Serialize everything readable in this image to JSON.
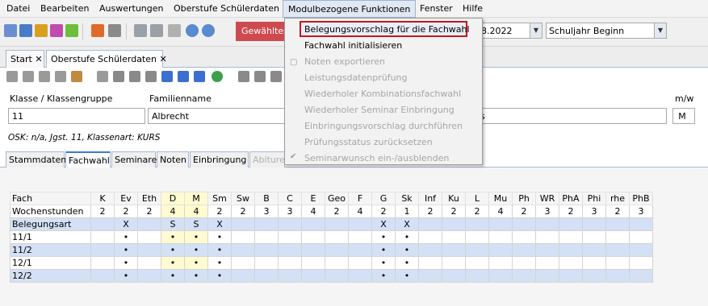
{
  "menu": [
    "Datei",
    "Bearbeiten",
    "Auswertungen",
    "Oberstufe Schülerdaten",
    "Modulbezogene Funktionen",
    "Fenster",
    "Hilfe"
  ],
  "toolbar": {
    "red_button": "Gewähltes",
    "date_value": "8.2022",
    "period_value": "Schuljahr Beginn"
  },
  "doc_tabs": [
    "Start",
    "Oberstufe Schülerdaten"
  ],
  "form": {
    "class_label": "Klasse / Klassengruppe",
    "class_value": "11",
    "surname_label": "Familienname",
    "surname_value": "Albrecht",
    "firstname_value": "s",
    "gender_label": "m/w",
    "gender_value": "M",
    "osk_info": "OSK: n/a, Jgst. 11, Klassenart: KURS"
  },
  "sub_tabs": [
    "Stammdaten",
    "Fachwahl",
    "Seminare",
    "Noten",
    "Einbringung",
    "Abiture"
  ],
  "grid": {
    "header": [
      "Fach",
      "K",
      "Ev",
      "Eth",
      "D",
      "M",
      "Sm",
      "Sw",
      "B",
      "C",
      "E",
      "Geo",
      "F",
      "G",
      "Sk",
      "Inf",
      "Ku",
      "L",
      "Mu",
      "Ph",
      "WR",
      "PhA",
      "Phi",
      "rhe",
      "PhB"
    ],
    "rows": [
      [
        "Wochenstunden",
        "2",
        "2",
        "2",
        "4",
        "4",
        "2",
        "2",
        "3",
        "3",
        "4",
        "2",
        "4",
        "2",
        "1",
        "2",
        "2",
        "2",
        "4",
        "2",
        "3",
        "2",
        "3",
        "2",
        "3"
      ],
      [
        "Belegungsart",
        "",
        "X",
        "",
        "S",
        "S",
        "X",
        "",
        "",
        "",
        "",
        "",
        "",
        "X",
        "X",
        "",
        "",
        "",
        "",
        "",
        "",
        "",
        "",
        "",
        ""
      ],
      [
        "11/1",
        "",
        "•",
        "",
        "•",
        "•",
        "•",
        "",
        "",
        "",
        "",
        "",
        "",
        "•",
        "•",
        "",
        "",
        "",
        "",
        "",
        "",
        "",
        "",
        "",
        ""
      ],
      [
        "11/2",
        "",
        "•",
        "",
        "•",
        "•",
        "•",
        "",
        "",
        "",
        "",
        "",
        "",
        "•",
        "•",
        "",
        "",
        "",
        "",
        "",
        "",
        "",
        "",
        "",
        ""
      ],
      [
        "12/1",
        "",
        "•",
        "",
        "•",
        "•",
        "•",
        "",
        "",
        "",
        "",
        "",
        "",
        "•",
        "•",
        "",
        "",
        "",
        "",
        "",
        "",
        "",
        "",
        "",
        ""
      ],
      [
        "12/2",
        "",
        "•",
        "",
        "•",
        "•",
        "•",
        "",
        "",
        "",
        "",
        "",
        "",
        "•",
        "•",
        "",
        "",
        "",
        "",
        "",
        "",
        "",
        "",
        "",
        ""
      ]
    ]
  },
  "dropdown": {
    "items": [
      {
        "label": "Belegungsvorschlag für die Fachwahl",
        "enabled": true
      },
      {
        "label": "Fachwahl initialisieren",
        "enabled": true
      },
      {
        "label": "Noten exportieren",
        "enabled": false
      },
      {
        "label": "Leistungsdatenprüfung",
        "enabled": false
      },
      {
        "label": "Wiederholer Kombinationsfachwahl",
        "enabled": false
      },
      {
        "label": "Wiederholer Seminar Einbringung",
        "enabled": false
      },
      {
        "label": "Einbringungsvorschlag durchführen",
        "enabled": false
      },
      {
        "label": "Prüfungsstatus zurücksetzen",
        "enabled": false
      },
      {
        "label": "Seminarwunsch ein-/ausblenden",
        "enabled": false
      }
    ]
  },
  "colors": {
    "accent_red": "#c8161d",
    "selected_row_blue": "#d3e0f5",
    "highlight_yellow": "#fffbd0"
  }
}
